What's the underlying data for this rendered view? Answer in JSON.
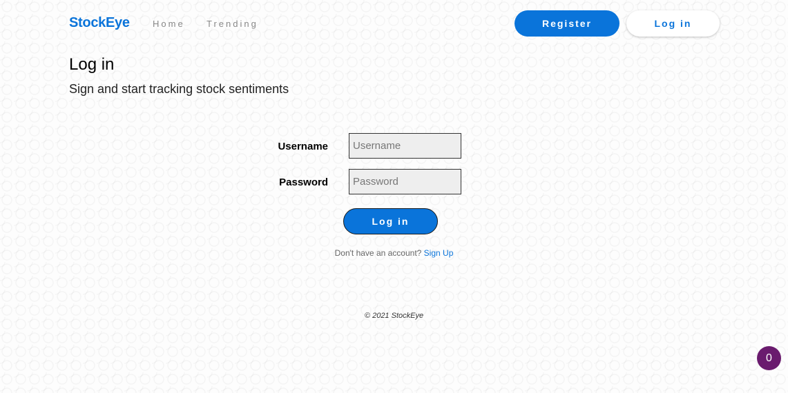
{
  "nav": {
    "brand": "StockEye",
    "links": [
      "Home",
      "Trending"
    ],
    "register_label": "Register",
    "login_label": "Log in"
  },
  "main": {
    "title": "Log in",
    "subtitle": "Sign and start tracking stock sentiments"
  },
  "form": {
    "username_label": "Username",
    "username_placeholder": "Username",
    "username_value": "",
    "password_label": "Password",
    "password_placeholder": "Password",
    "password_value": "",
    "submit_label": "Log in",
    "signup_prompt": "Don't have an account?",
    "signup_link": "Sign Up"
  },
  "footer": {
    "copyright": "© 2021 StockEye"
  },
  "badge": {
    "count": "0"
  },
  "colors": {
    "accent": "#0a74da",
    "badge": "#6a1b6e"
  }
}
